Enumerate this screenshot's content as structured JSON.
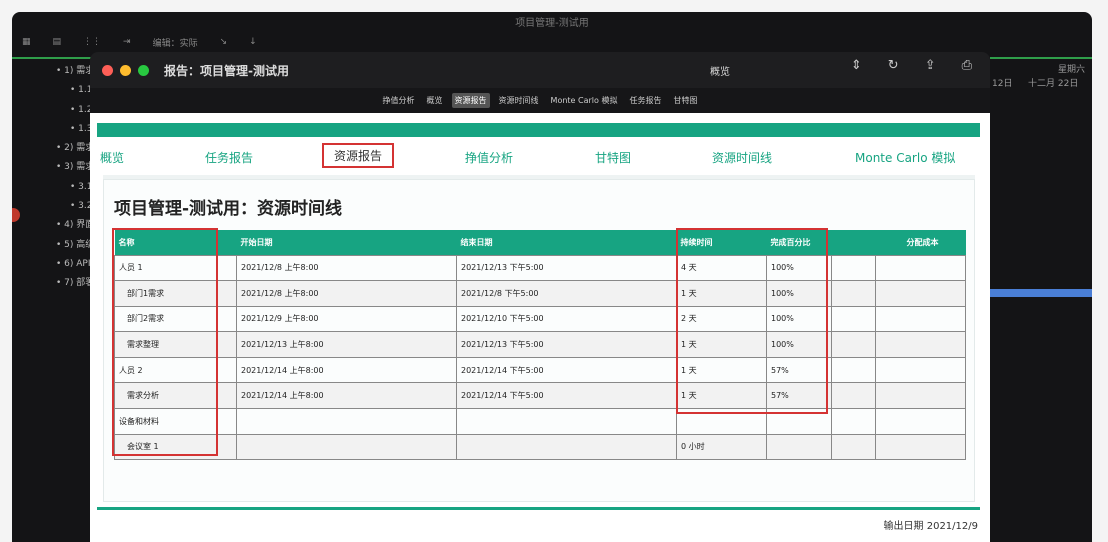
{
  "background_app": {
    "title": "项目管理-测试用",
    "toolbar_label": "编辑：实际",
    "sidebar": [
      "• 1) 需求",
      "• 1.1)",
      "• 1.2)",
      "• 1.3)",
      "• 2) 需求",
      "• 3) 需求",
      "• 3.1)",
      "• 3.2)",
      "• 4) 界面",
      "• 5) 高级",
      "• 6) API",
      "• 7) 部署"
    ],
    "header_right": [
      "12日",
      "十二月 22日",
      "星期六"
    ]
  },
  "report_window": {
    "title": "报告：项目管理-测试用",
    "center_label": "概览",
    "print_label": "打印",
    "toolbar_tabs": [
      {
        "label": "挣值分析"
      },
      {
        "label": "概览"
      },
      {
        "label": "资源报告",
        "active": true
      },
      {
        "label": "资源时间线"
      },
      {
        "label": "Monte Carlo 模拟"
      },
      {
        "label": "任务报告"
      },
      {
        "label": "甘特图"
      }
    ]
  },
  "nav": [
    {
      "label": "概览"
    },
    {
      "label": "任务报告"
    },
    {
      "label": "资源报告",
      "active": true
    },
    {
      "label": "挣值分析"
    },
    {
      "label": "甘特图"
    },
    {
      "label": "资源时间线"
    },
    {
      "label": "Monte Carlo 模拟"
    }
  ],
  "page_title": "项目管理-测试用：资源时间线",
  "table": {
    "headers": [
      "名称",
      "开始日期",
      "结束日期",
      "持续时间",
      "完成百分比",
      "分配成本"
    ],
    "rows": [
      {
        "name": "人员 1",
        "start": "2021/12/8 上午8:00",
        "end": "2021/12/13 下午5:00",
        "duration": "4 天",
        "percent": "100%",
        "cost": "",
        "indent": false
      },
      {
        "name": "部门1需求",
        "start": "2021/12/8 上午8:00",
        "end": "2021/12/8 下午5:00",
        "duration": "1 天",
        "percent": "100%",
        "cost": "",
        "indent": true
      },
      {
        "name": "部门2需求",
        "start": "2021/12/9 上午8:00",
        "end": "2021/12/10 下午5:00",
        "duration": "2 天",
        "percent": "100%",
        "cost": "",
        "indent": true
      },
      {
        "name": "需求整理",
        "start": "2021/12/13 上午8:00",
        "end": "2021/12/13 下午5:00",
        "duration": "1 天",
        "percent": "100%",
        "cost": "",
        "indent": true
      },
      {
        "name": "人员 2",
        "start": "2021/12/14 上午8:00",
        "end": "2021/12/14 下午5:00",
        "duration": "1 天",
        "percent": "57%",
        "cost": "",
        "indent": false
      },
      {
        "name": "需求分析",
        "start": "2021/12/14 上午8:00",
        "end": "2021/12/14 下午5:00",
        "duration": "1 天",
        "percent": "57%",
        "cost": "",
        "indent": true
      },
      {
        "name": "设备和材料",
        "start": "",
        "end": "",
        "duration": "",
        "percent": "",
        "cost": "",
        "indent": false
      },
      {
        "name": "会议室 1",
        "start": "",
        "end": "",
        "duration": "0 小时",
        "percent": "",
        "cost": "",
        "indent": true
      }
    ]
  },
  "footer": "输出日期 2021/12/9",
  "colors": {
    "accent": "#17a482",
    "highlight": "#d43333"
  }
}
